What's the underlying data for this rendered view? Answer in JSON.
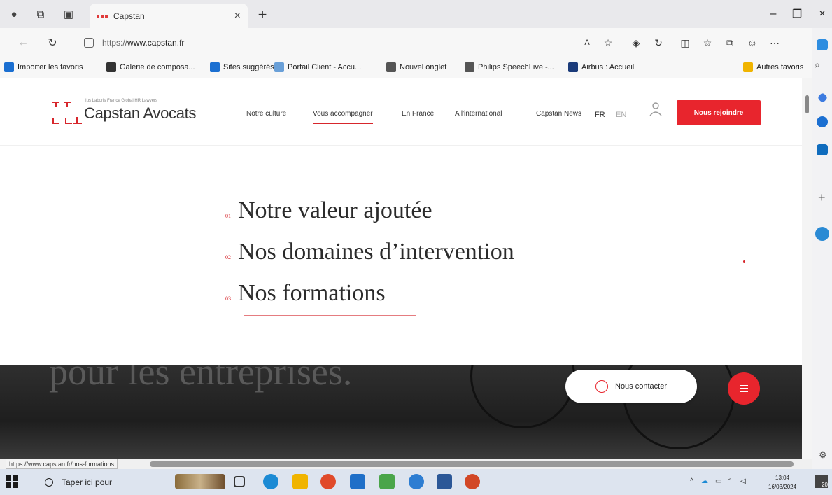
{
  "browser": {
    "tab_title": "Capstan",
    "tab_close": "×",
    "new_tab": "+",
    "url_proto": "https://",
    "url_host": "www.capstan.fr",
    "controls": {
      "minimize": "–",
      "restore": "❐",
      "close": "×"
    },
    "toolbar_icons": [
      "read-aloud-icon",
      "favorite-star-icon",
      "extensions-icon",
      "refresh-icon",
      "split-screen-icon",
      "favorites-icon",
      "collections-icon",
      "feedback-icon",
      "more-icon"
    ],
    "more_label": "···",
    "favorites": [
      {
        "label": "Importer les favoris",
        "color": "#1b6fd1"
      },
      {
        "label": "Galerie de composa...",
        "color": "#333333"
      },
      {
        "label": "Sites suggérés",
        "color": "#1b6fd1"
      },
      {
        "label": "Portail Client - Accu...",
        "color": "#6aa0d8"
      },
      {
        "label": "Nouvel onglet",
        "color": "#555555"
      },
      {
        "label": "Philips SpeechLive -...",
        "color": "#555555"
      },
      {
        "label": "Airbus : Accueil",
        "color": "#1b3b7a"
      },
      {
        "label": "Autres favoris",
        "color": "#f0b400"
      }
    ]
  },
  "site": {
    "logo_tagline": "Ius Laboris France Global HR Lawyers",
    "logo_name": "Capstan Avocats",
    "nav": [
      "Notre culture",
      "Vous accompagner",
      "En France",
      "A l'international",
      "Capstan News"
    ],
    "lang_fr": "FR",
    "lang_en": "EN",
    "join_label": "Nous rejoindre",
    "menu": [
      {
        "num": "01",
        "label": "Notre valeur ajoutée"
      },
      {
        "num": "02",
        "label": "Nos domaines d’intervention"
      },
      {
        "num": "03",
        "label": "Nos formations"
      }
    ],
    "ghost_heading": "pour les entreprises.",
    "contact_label": "Nous contacter",
    "accent": "#e8252d"
  },
  "status_url": "https://www.capstan.fr/nos-formations",
  "taskbar": {
    "search_placeholder": "Taper ici pour",
    "time": "13:04",
    "date": "16/03/2024",
    "notifications": "20"
  }
}
